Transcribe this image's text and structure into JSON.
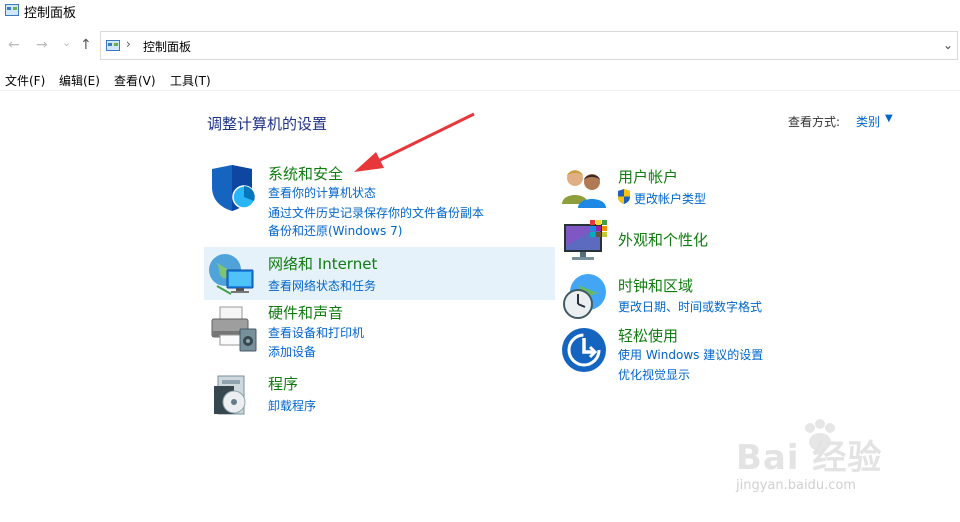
{
  "window": {
    "title": "控制面板"
  },
  "nav": {
    "back": "←",
    "forward": "→",
    "recent": "⌄",
    "up": "↑"
  },
  "address": {
    "separator": "›",
    "crumb": "控制面板",
    "dropdown": "⌄"
  },
  "menu": {
    "file": "文件(F)",
    "edit": "编辑(E)",
    "view": "查看(V)",
    "tools": "工具(T)"
  },
  "heading": "调整计算机的设置",
  "view_by": {
    "label": "查看方式:",
    "value": "类别",
    "arrow": "▼"
  },
  "categories": {
    "system_security": {
      "title": "系统和安全",
      "links": [
        "查看你的计算机状态",
        "通过文件历史记录保存你的文件备份副本",
        "备份和还原(Windows 7)"
      ]
    },
    "network": {
      "title": "网络和 Internet",
      "links": [
        "查看网络状态和任务"
      ]
    },
    "hardware": {
      "title": "硬件和声音",
      "links": [
        "查看设备和打印机",
        "添加设备"
      ]
    },
    "programs": {
      "title": "程序",
      "links": [
        "卸载程序"
      ]
    },
    "user_accounts": {
      "title": "用户帐户",
      "links": [
        "更改帐户类型"
      ]
    },
    "appearance": {
      "title": "外观和个性化",
      "links": []
    },
    "clock": {
      "title": "时钟和区域",
      "links": [
        "更改日期、时间或数字格式"
      ]
    },
    "ease": {
      "title": "轻松使用",
      "links": [
        "使用 Windows 建议的设置",
        "优化视觉显示"
      ]
    }
  },
  "watermark": {
    "brand": "Bai 经验",
    "url": "jingyan.baidu.com"
  },
  "colors": {
    "link": "#0066cc",
    "category_title": "#107c10",
    "heading": "#1e3287",
    "highlight": "#e6f2fa",
    "annotation_arrow": "#e8373a"
  },
  "icons": [
    "control-panel-icon",
    "shield-icon",
    "network-icon",
    "printer-icon",
    "programs-icon",
    "users-icon",
    "uac-shield-icon",
    "monitor-icon",
    "clock-icon",
    "ease-of-access-icon"
  ]
}
